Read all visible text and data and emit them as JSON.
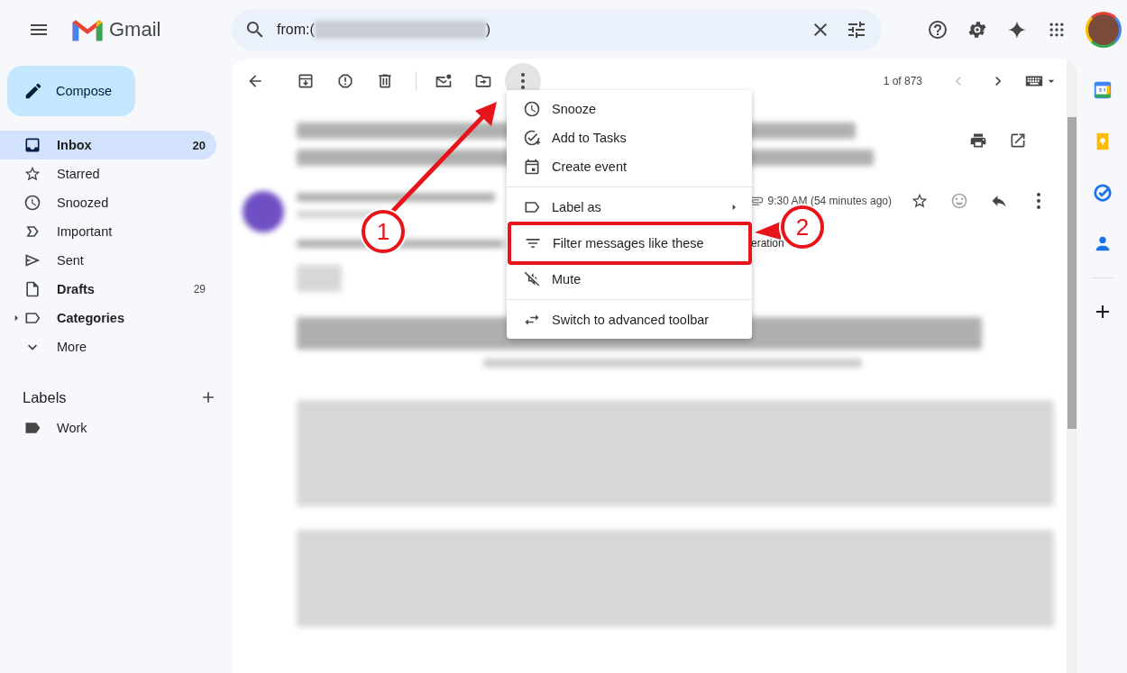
{
  "topbar": {
    "app_name": "Gmail",
    "search": {
      "value_start": "from:(",
      "value_end": ")"
    }
  },
  "compose": {
    "label": "Compose"
  },
  "sidebar": {
    "items": [
      {
        "label": "Inbox",
        "count": "20",
        "selected": true,
        "unread": true,
        "kind": "folder"
      },
      {
        "label": "Starred",
        "selected": false,
        "unread": false,
        "kind": "folder"
      },
      {
        "label": "Snoozed",
        "selected": false,
        "unread": false,
        "kind": "folder"
      },
      {
        "label": "Important",
        "selected": false,
        "unread": false,
        "kind": "folder"
      },
      {
        "label": "Sent",
        "selected": false,
        "unread": false,
        "kind": "folder"
      },
      {
        "label": "Drafts",
        "count": "29",
        "selected": false,
        "unread": true,
        "kind": "folder"
      },
      {
        "label": "Categories",
        "selected": false,
        "unread": true,
        "kind": "group"
      },
      {
        "label": "More",
        "selected": false,
        "unread": false,
        "kind": "toggle"
      }
    ]
  },
  "labels": {
    "title": "Labels",
    "items": [
      {
        "label": "Work"
      }
    ]
  },
  "mail": {
    "more_active": true,
    "pager": "1 of 873",
    "prev_disabled": true,
    "time": "9:30 AM (54 minutes ago)",
    "partial_text": "eration"
  },
  "menu": {
    "groups": [
      [
        {
          "label": "Snooze",
          "submenu": false,
          "highlighted": false
        },
        {
          "label": "Add to Tasks",
          "submenu": false,
          "highlighted": false
        },
        {
          "label": "Create event",
          "submenu": false,
          "highlighted": false
        }
      ],
      [
        {
          "label": "Label as",
          "submenu": true,
          "highlighted": false
        },
        {
          "label": "Filter messages like these",
          "submenu": false,
          "highlighted": true
        },
        {
          "label": "Mute",
          "submenu": false,
          "highlighted": false
        }
      ],
      [
        {
          "label": "Switch to advanced toolbar",
          "submenu": false,
          "highlighted": false
        }
      ]
    ]
  },
  "annotations": [
    {
      "label": "1"
    },
    {
      "label": "2"
    }
  ]
}
